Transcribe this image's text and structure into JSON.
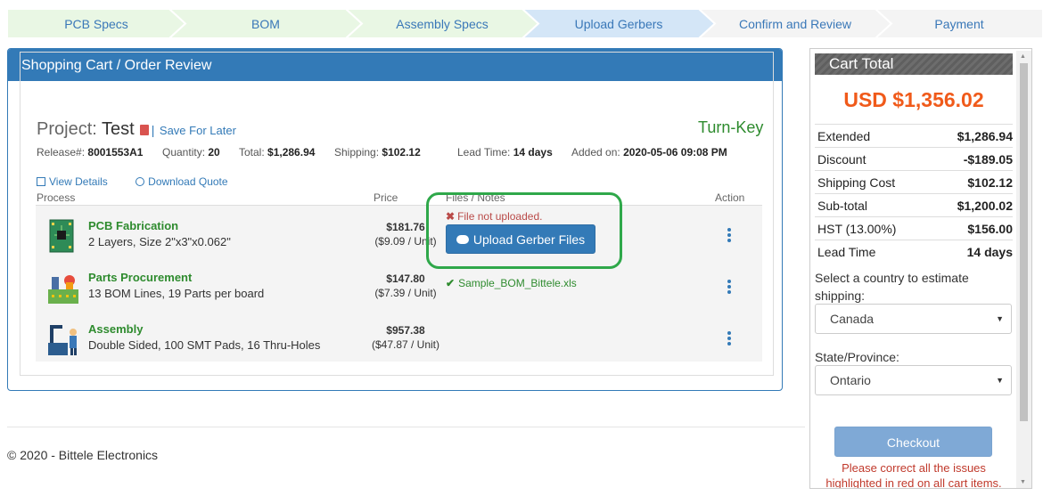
{
  "steps": [
    {
      "label": "PCB Specs",
      "state": "done"
    },
    {
      "label": "BOM",
      "state": "done"
    },
    {
      "label": "Assembly Specs",
      "state": "done"
    },
    {
      "label": "Upload Gerbers",
      "state": "active"
    },
    {
      "label": "Confirm and Review",
      "state": "pending"
    },
    {
      "label": "Payment",
      "state": "pending"
    }
  ],
  "colors": {
    "done": "#e9f7e4",
    "active": "#d4e6f7",
    "pending": "#f4f4f4",
    "accent": "#337ab7",
    "total": "#f05a1a",
    "ok": "#2e8b2e",
    "error": "#b94a48"
  },
  "panel": {
    "title": "Shopping Cart / Order Review"
  },
  "project": {
    "label": "Project:",
    "name": "Test",
    "save_later": "Save For Later",
    "type": "Turn-Key",
    "release_label": "Release#:",
    "release": "8001553A1",
    "quantity_label": "Quantity:",
    "quantity": "20",
    "total_label": "Total:",
    "total": "$1,286.94",
    "shipping_label": "Shipping:",
    "shipping": "$102.12",
    "lead_label": "Lead Time:",
    "lead": "14 days",
    "added_label": "Added on:",
    "added": "2020-05-06 09:08 PM",
    "view_details": "View Details",
    "download_quote": "Download Quote"
  },
  "table": {
    "headers": {
      "process": "Process",
      "price": "Price",
      "files": "Files / Notes",
      "action": "Action"
    },
    "rows": [
      {
        "name": "PCB Fabrication",
        "desc": "2 Layers, Size 2\"x3\"x0.062\"",
        "price": "$181.76",
        "unit": "($9.09 / Unit)",
        "icon": "pcb-icon"
      },
      {
        "name": "Parts Procurement",
        "desc": "13 BOM Lines, 19 Parts per board",
        "price": "$147.80",
        "unit": "($7.39 / Unit)",
        "icon": "parts-icon"
      },
      {
        "name": "Assembly",
        "desc": "Double Sided, 100 SMT Pads, 16 Thru-Holes",
        "price": "$957.38",
        "unit": "($47.87 / Unit)",
        "icon": "assembly-icon"
      }
    ],
    "file_error": "File not uploaded.",
    "upload_label": "Upload Gerber Files",
    "bom_file": "Sample_BOM_Bittele.xls"
  },
  "cart": {
    "title": "Cart Total",
    "total": "USD $1,356.02",
    "rows": [
      {
        "label": "Extended",
        "value": "$1,286.94"
      },
      {
        "label": "Discount",
        "value": "-$189.05"
      },
      {
        "label": "Shipping Cost",
        "value": "$102.12"
      },
      {
        "label": "Sub-total",
        "value": "$1,200.02"
      },
      {
        "label": "HST (13.00%)",
        "value": "$156.00"
      },
      {
        "label": "Lead Time",
        "value": "14 days"
      }
    ],
    "country_label": "Select a country to estimate shipping:",
    "country": "Canada",
    "province_label": "State/Province:",
    "province": "Ontario",
    "checkout": "Checkout",
    "warning": "Please correct all the issues highlighted in red on all cart items."
  },
  "footer": {
    "text": "© 2020 - Bittele Electronics"
  }
}
